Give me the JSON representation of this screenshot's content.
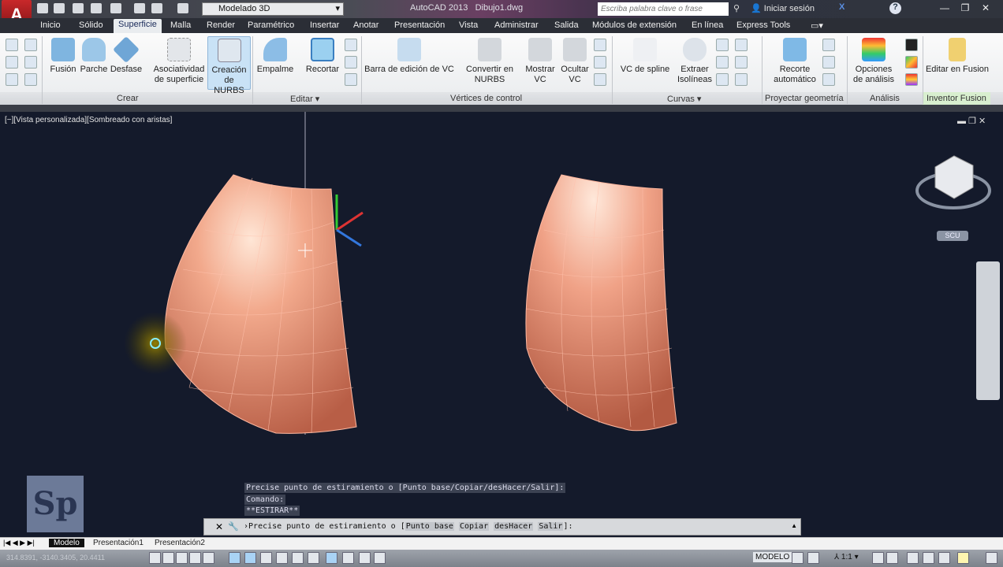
{
  "titlebar": {
    "workspace": "Modelado 3D",
    "app": "AutoCAD 2013",
    "file": "Dibujo1.dwg",
    "search_placeholder": "Escriba palabra clave o frase",
    "login": "Iniciar sesión",
    "app_logo": "A"
  },
  "tabs": [
    "Inicio",
    "Sólido",
    "Superficie",
    "Malla",
    "Render",
    "Paramétrico",
    "Insertar",
    "Anotar",
    "Presentación",
    "Vista",
    "Administrar",
    "Salida",
    "Módulos de extensión",
    "En línea",
    "Express Tools"
  ],
  "ribbon": {
    "crear": [
      "Fusión",
      "Parche",
      "Desfase",
      "Asociatividad de superficie",
      "Creación de NURBS"
    ],
    "editar": [
      "Empalme",
      "Recortar"
    ],
    "vc": [
      "Barra de edición de VC",
      "Convertir en NURBS",
      "Mostrar VC",
      "Ocultar VC"
    ],
    "curvas": [
      "VC de spline",
      "Extraer Isolíneas"
    ],
    "proyectar": [
      "Recorte automático"
    ],
    "analisis": [
      "Opciones de análisis"
    ],
    "fusion": [
      "Editar en Fusion"
    ],
    "panels": [
      "Crear",
      "Editar ▾",
      "Vértices de control",
      "Curvas ▾",
      "Proyectar geometría",
      "Análisis",
      "Inventor Fusion"
    ]
  },
  "viewport": {
    "label": "[−][Vista personalizada][Sombreado con aristas]",
    "ucs": "SCU",
    "logo": "Sp"
  },
  "command": {
    "history": [
      "Precise punto de estiramiento o [Punto base/Copiar/desHacer/Salir]:",
      "Comando:",
      "**ESTIRAR**"
    ],
    "prompt": "Precise punto de estiramiento o [",
    "options": [
      "Punto base",
      "Copiar",
      "desHacer",
      "Salir"
    ],
    "end": "]:"
  },
  "layouts": [
    "Modelo",
    "Presentación1",
    "Presentación2"
  ],
  "status": {
    "coords": "314.8391, -3140.3405, 20.4411",
    "mode": "MODELO",
    "scale": "1:1"
  }
}
